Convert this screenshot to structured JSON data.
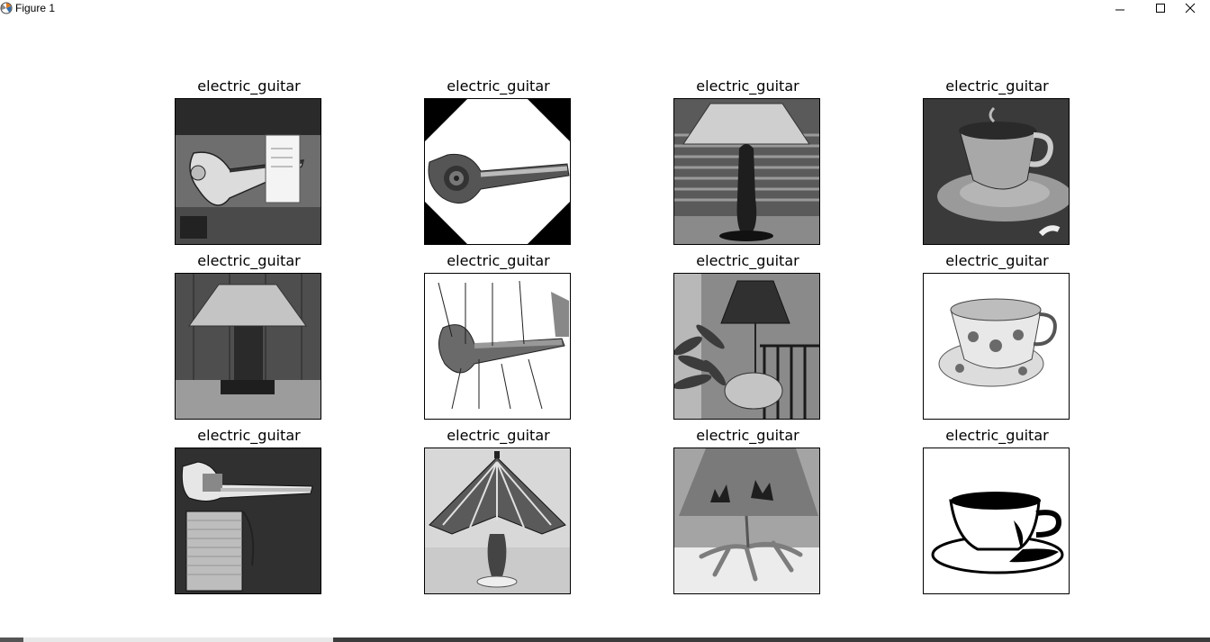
{
  "window": {
    "title": "Figure 1",
    "app_icon": "matplotlib-icon",
    "controls": {
      "minimize_icon": "minimize-icon",
      "maximize_icon": "maximize-icon",
      "close_icon": "close-icon"
    }
  },
  "figure": {
    "subplots": [
      {
        "title": "electric_guitar",
        "image": "guitar-on-stand-with-papers"
      },
      {
        "title": "electric_guitar",
        "image": "guitar-in-octagon"
      },
      {
        "title": "electric_guitar",
        "image": "statue-lamp-with-blinds"
      },
      {
        "title": "electric_guitar",
        "image": "teacup-on-saucer-drawing"
      },
      {
        "title": "electric_guitar",
        "image": "square-table-lamp"
      },
      {
        "title": "electric_guitar",
        "image": "guitar-parts-diagram"
      },
      {
        "title": "electric_guitar",
        "image": "lamp-with-fern"
      },
      {
        "title": "electric_guitar",
        "image": "floral-teacup"
      },
      {
        "title": "electric_guitar",
        "image": "guitar-with-amp"
      },
      {
        "title": "electric_guitar",
        "image": "tiffany-lamp"
      },
      {
        "title": "electric_guitar",
        "image": "wolf-lamp-antlers"
      },
      {
        "title": "electric_guitar",
        "image": "teacup-silhouette"
      }
    ]
  }
}
